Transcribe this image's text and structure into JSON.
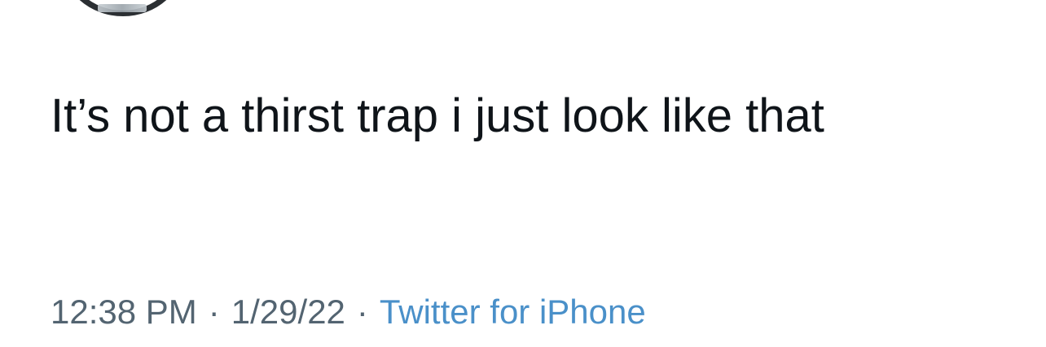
{
  "tweet": {
    "text": "It’s not a thirst trap i just look like that",
    "time": "12:38 PM",
    "separator": "·",
    "date": "1/29/22",
    "source": "Twitter for iPhone"
  },
  "colors": {
    "text": "#0f1419",
    "meta": "#536471",
    "link": "#4a90c9"
  },
  "icons": {
    "avatar": "profile-avatar"
  }
}
